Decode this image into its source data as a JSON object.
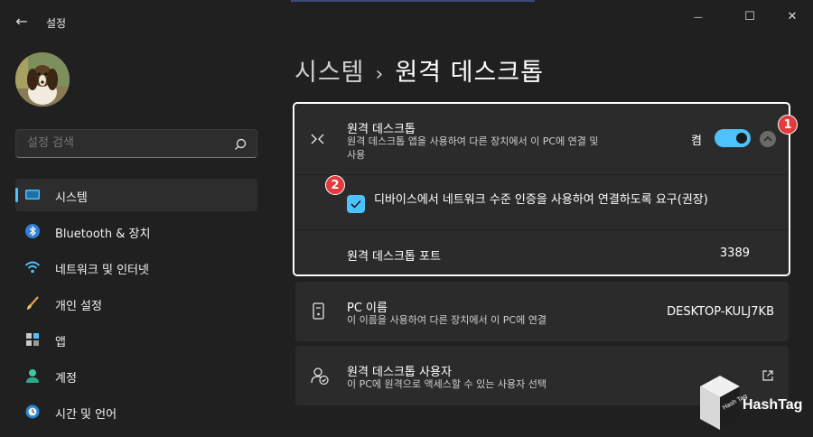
{
  "window": {
    "title": "설정",
    "back_icon": "←",
    "minimize_icon": "—",
    "maximize_icon": "☐",
    "close_icon": "✕"
  },
  "search": {
    "placeholder": "설정 검색"
  },
  "sidebar": {
    "items": [
      {
        "label": "시스템",
        "icon": "system-icon",
        "active": true
      },
      {
        "label": "Bluetooth & 장치",
        "icon": "bluetooth-icon"
      },
      {
        "label": "네트워크 및 인터넷",
        "icon": "wifi-icon"
      },
      {
        "label": "개인 설정",
        "icon": "brush-icon"
      },
      {
        "label": "앱",
        "icon": "apps-icon"
      },
      {
        "label": "계정",
        "icon": "account-icon"
      },
      {
        "label": "시간 및 언어",
        "icon": "clock-globe-icon"
      }
    ]
  },
  "breadcrumb": {
    "parent": "시스템",
    "separator": "›",
    "current": "원격 데스크톱"
  },
  "remote_desktop": {
    "title": "원격 데스크톱",
    "subtitle": "원격 데스크톱 앱을 사용하여 다른 장치에서 이 PC에 연결 및 사용",
    "toggle_label": "켬",
    "toggle_on": true,
    "nla_label": "디바이스에서 네트워크 수준 인증을 사용하여 연결하도록 요구(권장)",
    "nla_checked": true,
    "port_label": "원격 데스크톱 포트",
    "port_value": "3389"
  },
  "pc_name": {
    "title": "PC 이름",
    "subtitle": "이 이름을 사용하여 다른 장치에서 이 PC에 연결",
    "value": "DESKTOP-KULJ7KB"
  },
  "remote_users": {
    "title": "원격 데스크톱 사용자",
    "subtitle": "이 PC에 원격으로 액세스할 수 있는 사용자 선택"
  },
  "annotations": {
    "badge1": "1",
    "badge2": "2"
  },
  "watermark": {
    "text": "HashTag",
    "logo_text": "Hash Tag"
  },
  "colors": {
    "accent": "#4cc2ff",
    "badge": "#e23b3b",
    "background": "#202020",
    "card": "#2b2b2b"
  }
}
